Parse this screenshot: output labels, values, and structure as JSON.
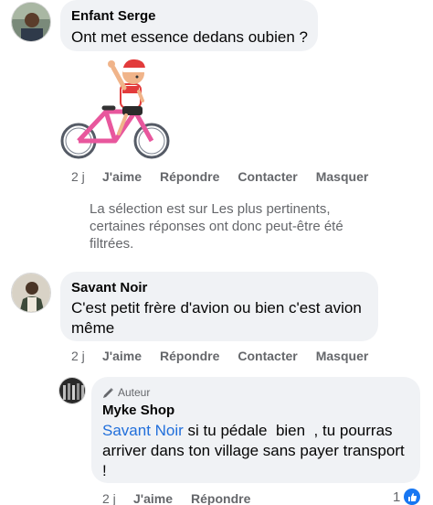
{
  "comments": [
    {
      "author": "Enfant Serge",
      "text": "Ont met essence dedans oubien ?",
      "sticker": "boy-on-pink-bicycle-sticker",
      "time": "2 j",
      "actions": {
        "like": "J'aime",
        "reply": "Répondre",
        "contact": "Contacter",
        "hide": "Masquer"
      }
    },
    {
      "author": "Savant Noir",
      "text_line1": "C'est petit frère d'avion ou bien c'est avion",
      "text_line2": "même",
      "time": "2 j",
      "actions": {
        "like": "J'aime",
        "reply": "Répondre",
        "contact": "Contacter",
        "hide": "Masquer"
      }
    }
  ],
  "filter_notice": {
    "line1": "La sélection est sur Les plus pertinents,",
    "line2": "certaines réponses ont donc peut-être été",
    "line3": "filtrées."
  },
  "reply": {
    "badge_icon": "pencil-icon",
    "badge_label": "Auteur",
    "author": "Myke Shop",
    "mention": "Savant Noir",
    "text_line1_rest": " si tu pédale  bien  , tu pourras",
    "text_line2": "arriver dans ton village sans payer transport",
    "text_line3": "!",
    "time": "2 j",
    "actions": {
      "like": "J'aime",
      "reply": "Répondre"
    },
    "reaction_count": "1",
    "reaction_icon": "like-thumb-icon"
  },
  "colors": {
    "bubble": "#f0f2f5",
    "secondary_text": "#65676b",
    "mention": "#216fdb",
    "like_blue": "#1877f2"
  }
}
